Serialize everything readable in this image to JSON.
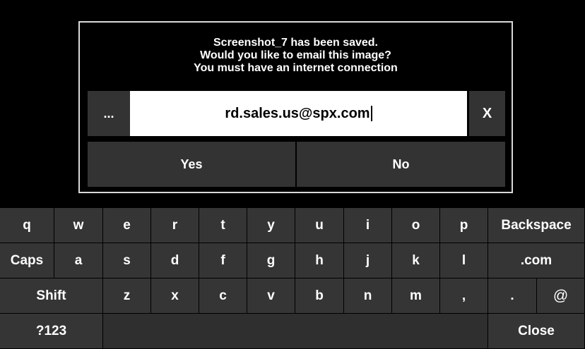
{
  "dialog": {
    "message_lines": [
      "Screenshot_7 has been saved.",
      "Would you like to email this image?",
      "You must have an internet connection"
    ],
    "dots_label": "...",
    "email_value": "rd.sales.us@spx.com",
    "clear_label": "X",
    "yes_label": "Yes",
    "no_label": "No"
  },
  "keyboard": {
    "row1": [
      "q",
      "w",
      "e",
      "r",
      "t",
      "y",
      "u",
      "i",
      "o",
      "p",
      "Backspace"
    ],
    "row2": [
      "Caps",
      "a",
      "s",
      "d",
      "f",
      "g",
      "h",
      "j",
      "k",
      "l",
      ".com"
    ],
    "row3": [
      "Shift",
      "z",
      "x",
      "c",
      "v",
      "b",
      "n",
      "m",
      ",",
      ".",
      "@"
    ],
    "row4": [
      "?123",
      "",
      "Close"
    ]
  }
}
